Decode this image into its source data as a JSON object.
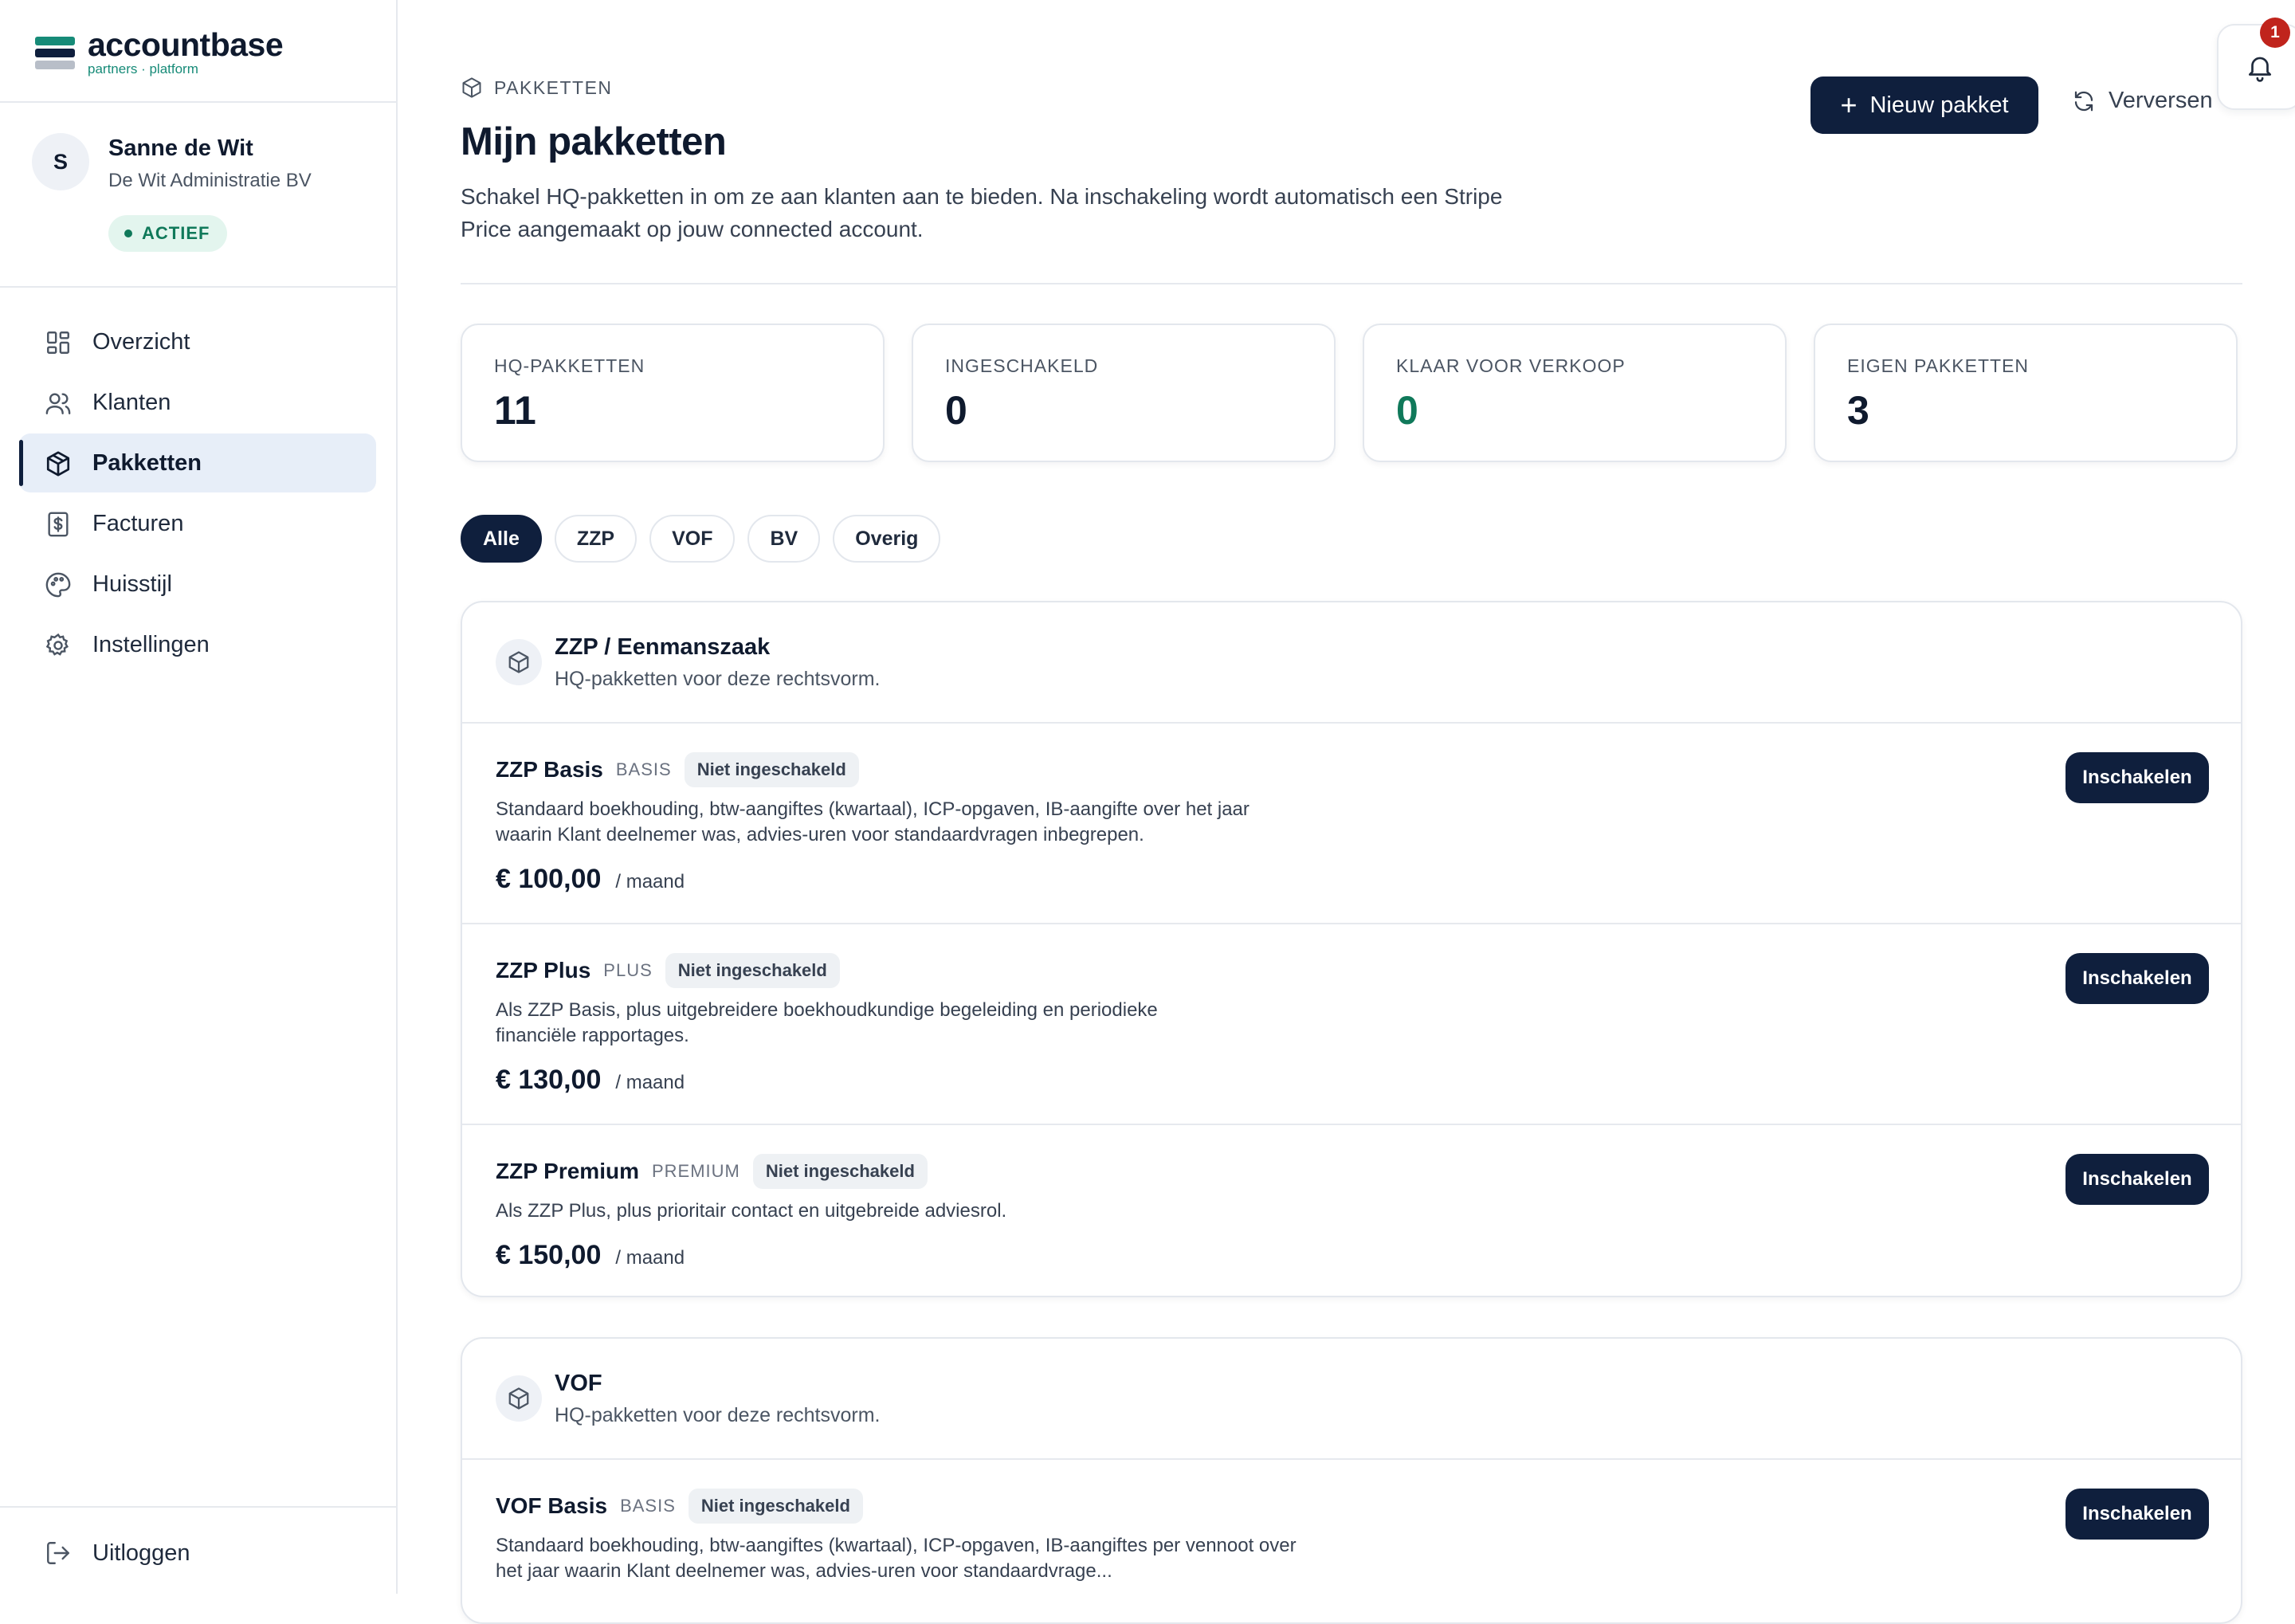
{
  "brand": {
    "name": "accountbase",
    "tagline": "partners · platform",
    "colors": {
      "navy": "#0f1f3d",
      "teal": "#178b78",
      "green": "#10795a",
      "alert": "#c0241c"
    }
  },
  "user": {
    "initial": "S",
    "name": "Sanne de Wit",
    "organization": "De Wit Administratie BV",
    "status": "ACTIEF"
  },
  "nav": [
    {
      "label": "Overzicht",
      "icon": "dashboard-icon",
      "active": false
    },
    {
      "label": "Klanten",
      "icon": "users-icon",
      "active": false
    },
    {
      "label": "Pakketten",
      "icon": "package-icon",
      "active": true
    },
    {
      "label": "Facturen",
      "icon": "invoice-icon",
      "active": false
    },
    {
      "label": "Huisstijl",
      "icon": "palette-icon",
      "active": false
    },
    {
      "label": "Instellingen",
      "icon": "gear-icon",
      "active": false
    }
  ],
  "logout": {
    "label": "Uitloggen",
    "icon": "logout-icon"
  },
  "header": {
    "eyebrow": "PAKKETTEN",
    "title": "Mijn pakketten",
    "description": "Schakel HQ-pakketten in om ze aan klanten aan te bieden. Na inschakeling wordt automatisch een Stripe Price aangemaakt op jouw connected account.",
    "new_button": "Nieuw pakket",
    "refresh_button": "Verversen",
    "notifications": "1"
  },
  "stats": [
    {
      "label": "HQ-PAKKETTEN",
      "value": "11",
      "color": "#0f1a2e"
    },
    {
      "label": "INGESCHAKELD",
      "value": "0",
      "color": "#0f1a2e"
    },
    {
      "label": "KLAAR VOOR VERKOOP",
      "value": "0",
      "color": "#10795a"
    },
    {
      "label": "EIGEN PAKKETTEN",
      "value": "3",
      "color": "#0f1a2e"
    }
  ],
  "filters": [
    {
      "label": "Alle",
      "active": true
    },
    {
      "label": "ZZP",
      "active": false
    },
    {
      "label": "VOF",
      "active": false
    },
    {
      "label": "BV",
      "active": false
    },
    {
      "label": "Overig",
      "active": false
    }
  ],
  "groups": [
    {
      "title": "ZZP / Eenmanszaak",
      "subtitle": "HQ-pakketten voor deze rechtsvorm.",
      "packages": [
        {
          "name": "ZZP Basis",
          "tier": "BASIS",
          "status": "Niet ingeschakeld",
          "description": "Standaard boekhouding, btw-aangiftes (kwartaal), ICP-opgaven, IB-aangifte over het jaar waarin Klant deelnemer was, advies-uren voor standaardvragen inbegrepen.",
          "price": "€ 100,00",
          "period": "/ maand",
          "action": "Inschakelen"
        },
        {
          "name": "ZZP Plus",
          "tier": "PLUS",
          "status": "Niet ingeschakeld",
          "description": "Als ZZP Basis, plus uitgebreidere boekhoudkundige begeleiding en periodieke financiële rapportages.",
          "price": "€ 130,00",
          "period": "/ maand",
          "action": "Inschakelen"
        },
        {
          "name": "ZZP Premium",
          "tier": "PREMIUM",
          "status": "Niet ingeschakeld",
          "description": "Als ZZP Plus, plus prioritair contact en uitgebreide adviesrol.",
          "price": "€ 150,00",
          "period": "/ maand",
          "action": "Inschakelen"
        }
      ]
    },
    {
      "title": "VOF",
      "subtitle": "HQ-pakketten voor deze rechtsvorm.",
      "packages": [
        {
          "name": "VOF Basis",
          "tier": "BASIS",
          "status": "Niet ingeschakeld",
          "description": "Standaard boekhouding, btw-aangiftes (kwartaal), ICP-opgaven, IB-aangiftes per vennoot over het jaar waarin Klant deelnemer was, advies-uren voor standaardvrage...",
          "price": "",
          "period": "",
          "action": "Inschakelen"
        }
      ]
    }
  ]
}
